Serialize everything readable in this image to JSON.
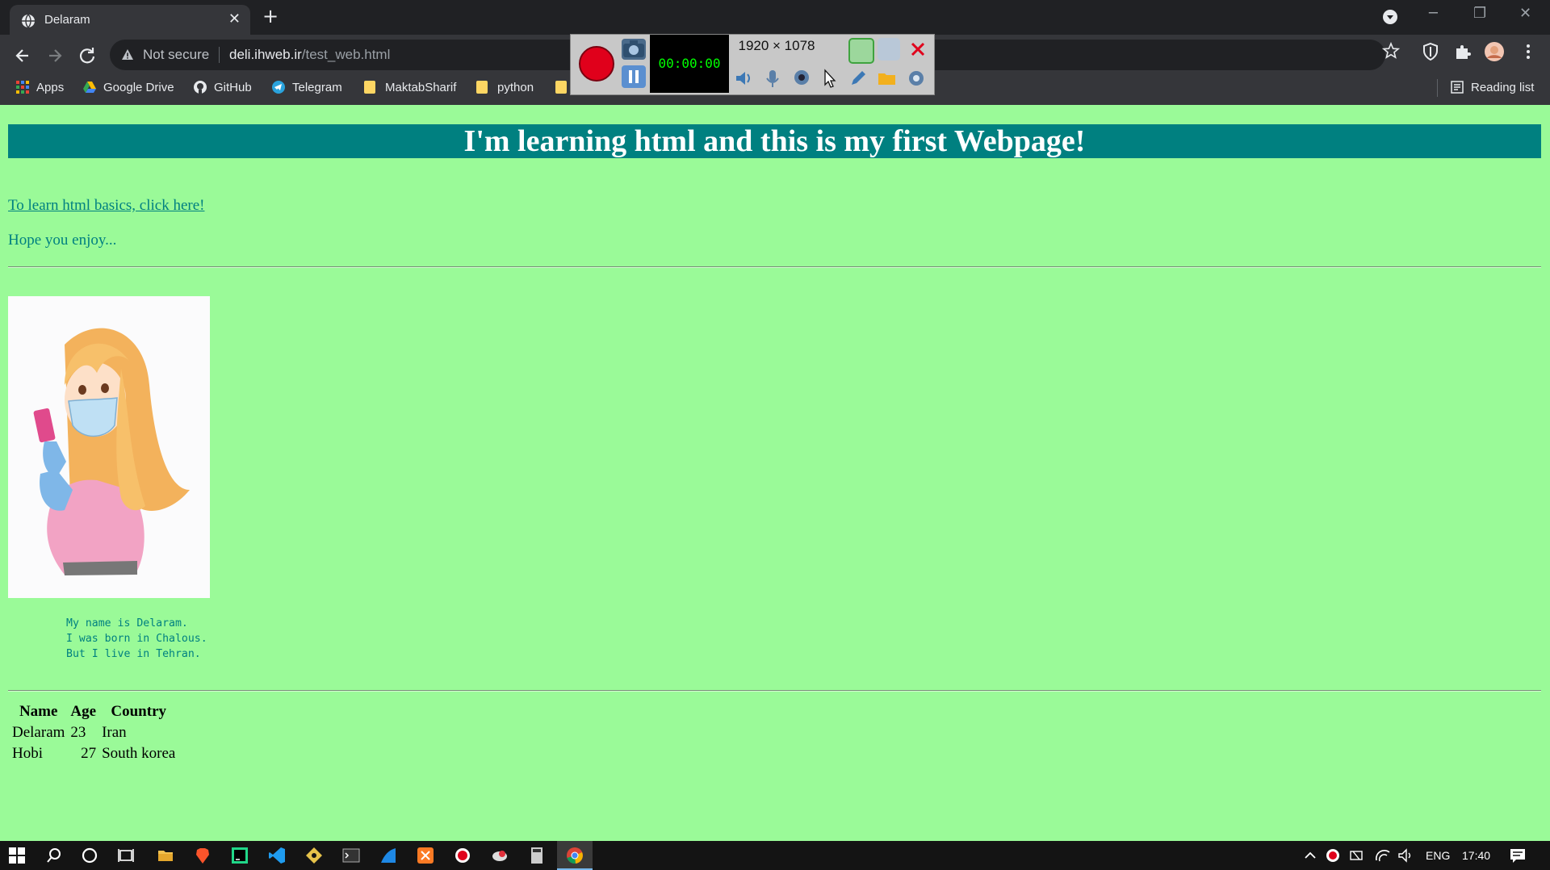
{
  "browser": {
    "tab_title": "Delaram",
    "tab_close": "✕",
    "new_tab": "+",
    "security_label": "Not secure",
    "url_host": "deli.ihweb.ir",
    "url_path": "/test_web.html",
    "bookmarks": [
      "Apps",
      "Google Drive",
      "GitHub",
      "Telegram",
      "MaktabSharif",
      "python"
    ],
    "reading_list": "Reading list"
  },
  "recorder": {
    "timer": "00:00:00",
    "size": "1920 × 1078"
  },
  "page": {
    "heading": "I'm learning html and this is my first Webpage!",
    "link_text": "To learn html basics, click here!",
    "hope_text": "Hope you enjoy...",
    "bio_lines": [
      "My name is Delaram.",
      "I was born in Chalous.",
      "But I live in Tehran."
    ],
    "table": {
      "headers": [
        "Name",
        "Age",
        "Country"
      ],
      "rows": [
        [
          "Delaram",
          "23",
          "Iran"
        ],
        [
          "Hobi",
          "27",
          "South korea"
        ]
      ]
    }
  },
  "taskbar": {
    "language": "ENG",
    "time": "17:40"
  },
  "colors": {
    "page_background": "#9afa98",
    "heading_background": "#008080",
    "text_teal": "#008080"
  }
}
